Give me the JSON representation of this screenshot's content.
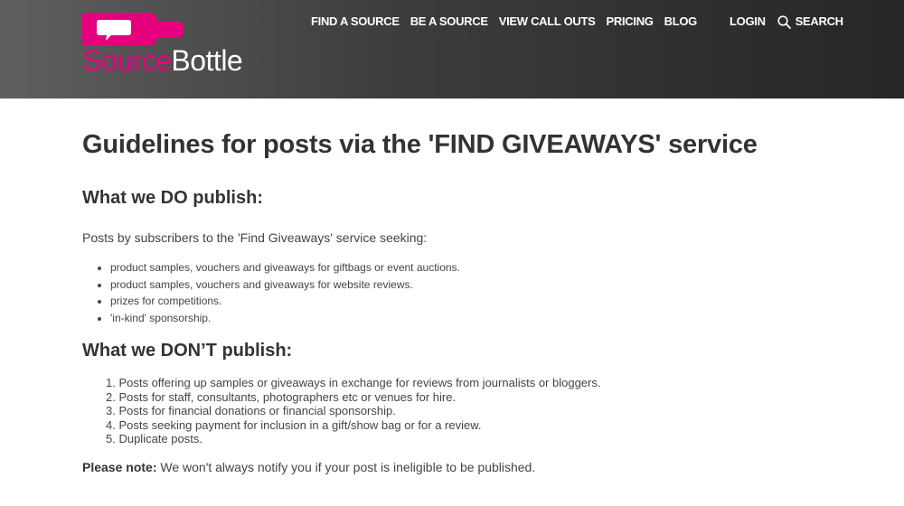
{
  "header": {
    "logo": {
      "source_text": "Source",
      "bottle_text": "Bottle",
      "brand_color": "#e6007e"
    },
    "nav": [
      {
        "label": "FIND A SOURCE"
      },
      {
        "label": "BE A SOURCE"
      },
      {
        "label": "VIEW CALL OUTS"
      },
      {
        "label": "PRICING"
      },
      {
        "label": "BLOG"
      }
    ],
    "login_label": "LOGIN",
    "search_label": "SEARCH",
    "search_icon": "magnifier-icon"
  },
  "main": {
    "title": "Guidelines for posts via the 'FIND GIVEAWAYS' service",
    "do_heading": "What we DO publish:",
    "intro": "Posts by subscribers to the 'Find Giveaways' service seeking:",
    "do_items": [
      "product samples, vouchers and giveaways for giftbags or event auctions.",
      "product samples, vouchers and giveaways for website reviews.",
      "prizes for competitions.",
      "'in-kind' sponsorship."
    ],
    "dont_heading": "What we DON’T publish:",
    "dont_items": [
      "1. Posts offering up samples or giveaways in exchange for reviews from journalists or bloggers.",
      "2. Posts for staff, consultants, photographers etc or venues for hire.",
      "3. Posts for financial donations or financial sponsorship.",
      "4. Posts seeking payment for inclusion in a gift/show bag or for a review.",
      "5. Duplicate posts."
    ],
    "note_label": "Please note:",
    "note_text": " We won't always notify you if your post is ineligible to be published."
  }
}
